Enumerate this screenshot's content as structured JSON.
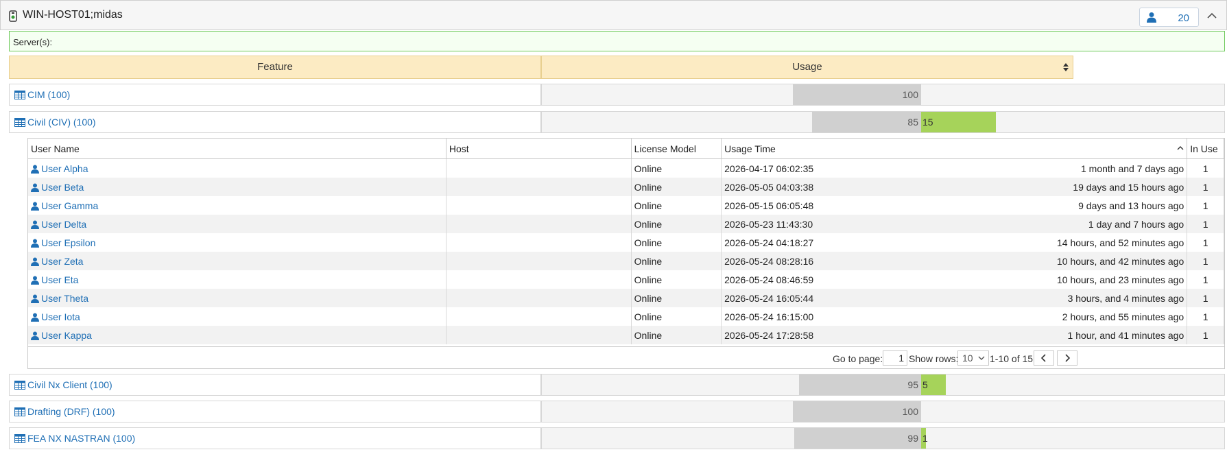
{
  "header": {
    "title": "WIN-HOST01;midas",
    "user_count": "20"
  },
  "servers_label": "Server(s):",
  "columns": {
    "feature": "Feature",
    "usage": "Usage"
  },
  "features": [
    {
      "name": "CIM (100)",
      "used": 100,
      "extra": null,
      "total": 100
    },
    {
      "name": "Civil (CIV) (100)",
      "used": 85,
      "extra": 15,
      "total": 100
    },
    {
      "name": "Civil Nx Client (100)",
      "used": 95,
      "extra": 5,
      "total": 100
    },
    {
      "name": "Drafting (DRF) (100)",
      "used": 100,
      "extra": null,
      "total": 100
    },
    {
      "name": "FEA NX NASTRAN (100)",
      "used": 99,
      "extra": 1,
      "total": 100
    }
  ],
  "users_table": {
    "headers": {
      "user": "User Name",
      "host": "Host",
      "model": "License Model",
      "time": "Usage Time",
      "inuse": "In Use"
    },
    "rows": [
      {
        "user": "User Alpha",
        "host": "",
        "model": "Online",
        "time": "2026-04-17 06:02:35",
        "ago": "1 month and 7 days ago",
        "inuse": "1"
      },
      {
        "user": "User Beta",
        "host": "",
        "model": "Online",
        "time": "2026-05-05 04:03:38",
        "ago": "19 days and 15 hours ago",
        "inuse": "1"
      },
      {
        "user": "User Gamma",
        "host": "",
        "model": "Online",
        "time": "2026-05-15 06:05:48",
        "ago": "9 days and 13 hours ago",
        "inuse": "1"
      },
      {
        "user": "User Delta",
        "host": "",
        "model": "Online",
        "time": "2026-05-23 11:43:30",
        "ago": "1 day and 7 hours ago",
        "inuse": "1"
      },
      {
        "user": "User Epsilon",
        "host": "",
        "model": "Online",
        "time": "2026-05-24 04:18:27",
        "ago": "14 hours, and 52 minutes ago",
        "inuse": "1"
      },
      {
        "user": "User Zeta",
        "host": "",
        "model": "Online",
        "time": "2026-05-24 08:28:16",
        "ago": "10 hours, and 42 minutes ago",
        "inuse": "1"
      },
      {
        "user": "User Eta",
        "host": "",
        "model": "Online",
        "time": "2026-05-24 08:46:59",
        "ago": "10 hours, and 23 minutes ago",
        "inuse": "1"
      },
      {
        "user": "User Theta",
        "host": "",
        "model": "Online",
        "time": "2026-05-24 16:05:44",
        "ago": "3 hours, and 4 minutes ago",
        "inuse": "1"
      },
      {
        "user": "User Iota",
        "host": "",
        "model": "Online",
        "time": "2026-05-24 16:15:00",
        "ago": "2 hours, and 55 minutes ago",
        "inuse": "1"
      },
      {
        "user": "User Kappa",
        "host": "",
        "model": "Online",
        "time": "2026-05-24 17:28:58",
        "ago": "1 hour, and 41 minutes ago",
        "inuse": "1"
      }
    ]
  },
  "pager": {
    "goto_label": "Go to page:",
    "page": "1",
    "rows_label": "Show rows:",
    "rows_value": "10",
    "range": "1-10 of 15"
  },
  "colors": {
    "accent": "#1f6fb5",
    "bar_used": "#d0d0d0",
    "bar_free": "#a6d35a",
    "header_bg": "#fcebc3"
  }
}
